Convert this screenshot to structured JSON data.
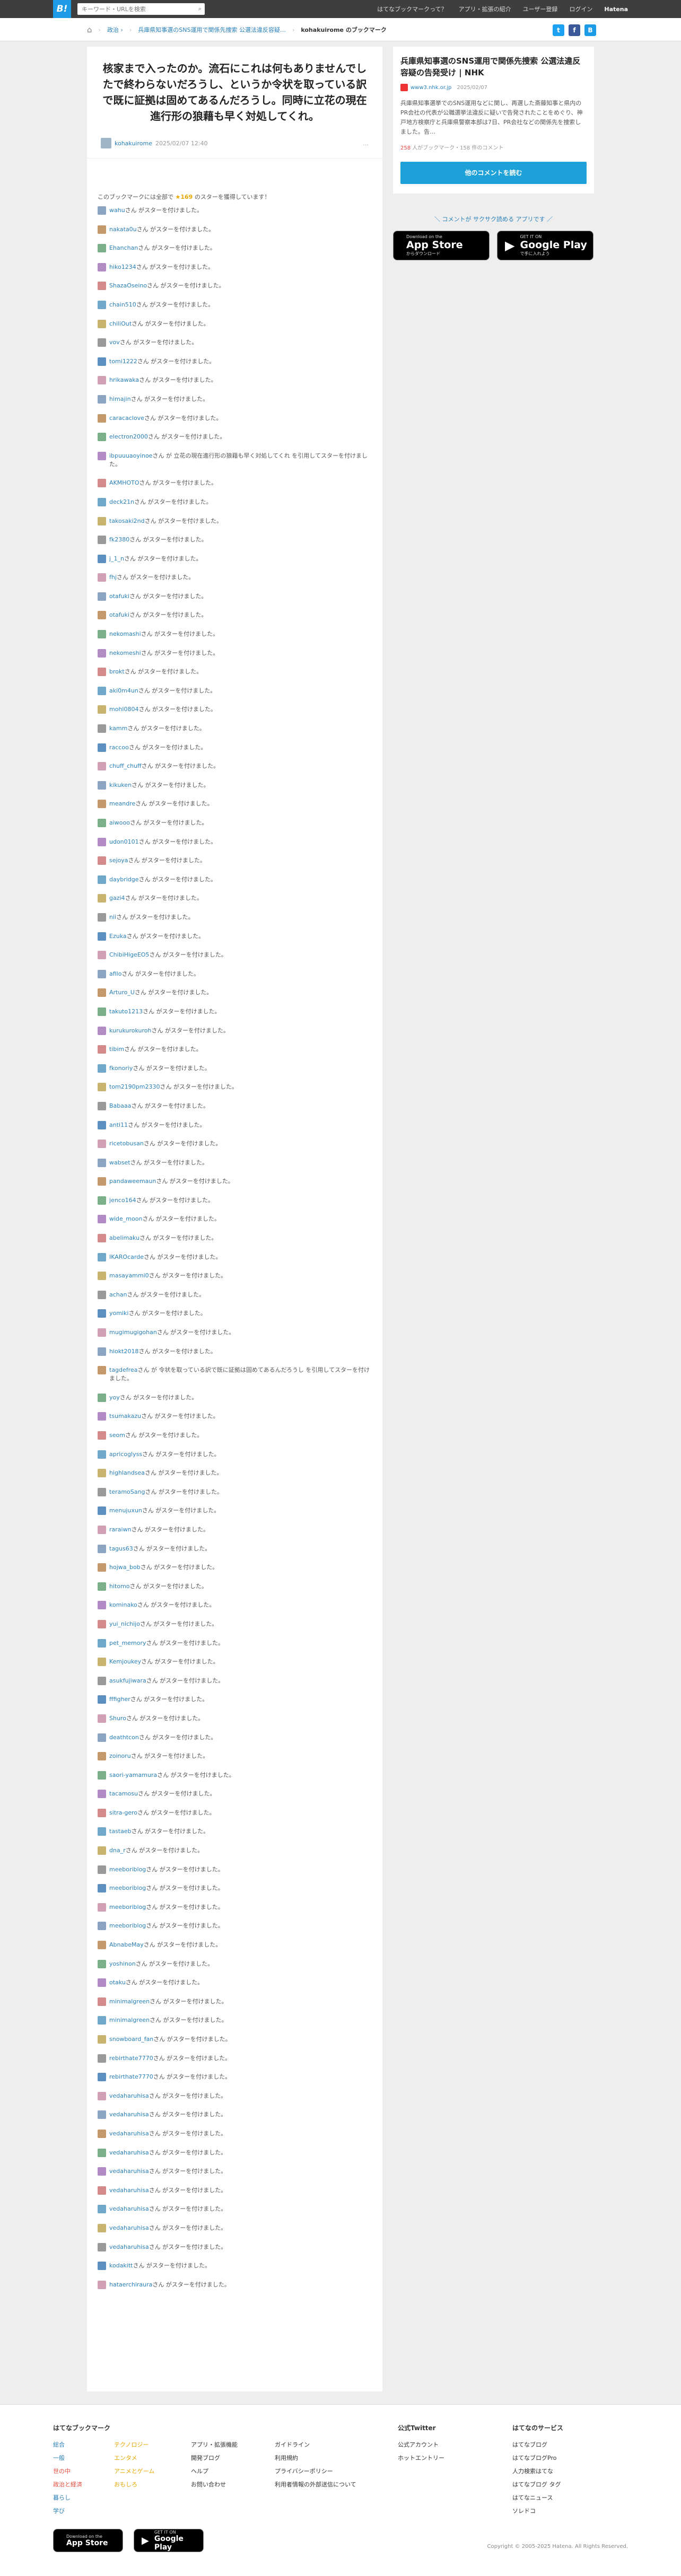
{
  "topbar": {
    "logo": "B!",
    "search_placeholder": "キーワード・URLを検索",
    "nav": [
      "はてなブックマークって？",
      "アプリ・拡張の紹介",
      "ユーザー登録",
      "ログイン",
      "Hatena"
    ]
  },
  "breadcrumb": {
    "items": [
      "政治 ›",
      "兵庫県知事選のSNS運用で関係先捜索 公選法違反容疑…",
      "kohakuirome のブックマーク"
    ]
  },
  "comment": {
    "text": "核家まで入ったのか。流石にこれは何もありませんでしたで終わらないだろうし、というか令状を取っている訳で既に証拠は固めてあるんだろうし。同時に立花の現在進行形の狼藉も早く対処してくれ。",
    "user": "kohakuirome",
    "date": "2025/02/07 12:40",
    "more": "…"
  },
  "stars": {
    "head_prefix": "このブックマークには全部で",
    "count": "★169",
    "head_suffix": "のスターを獲得しています！",
    "rows": [
      {
        "user": "wahu",
        "msg": "さん がスターを付けました。"
      },
      {
        "user": "nakata0u",
        "msg": "さん がスターを付けました。"
      },
      {
        "user": "Ehanchan",
        "msg": "さん がスターを付けました。"
      },
      {
        "user": "hiko1234",
        "msg": "さん がスターを付けました。"
      },
      {
        "user": "ShazaOseino",
        "msg": "さん がスターを付けました。"
      },
      {
        "user": "chain510",
        "msg": "さん がスターを付けました。"
      },
      {
        "user": "chiliOut",
        "msg": "さん がスターを付けました。"
      },
      {
        "user": "vov",
        "msg": "さん がスターを付けました。"
      },
      {
        "user": "tomi1222",
        "msg": "さん がスターを付けました。"
      },
      {
        "user": "hrikawaka",
        "msg": "さん がスターを付けました。"
      },
      {
        "user": "himajin",
        "msg": "さん がスターを付けました。"
      },
      {
        "user": "caracaclove",
        "msg": "さん がスターを付けました。"
      },
      {
        "user": "electron2000",
        "msg": "さん がスターを付けました。"
      },
      {
        "user": "ibpuuuaoyinoe",
        "msg": "さん が 立花の現在進行形の狼藉も早く対処してくれ を引用してスターを付けました。"
      },
      {
        "user": "AKMHOTO",
        "msg": "さん がスターを付けました。"
      },
      {
        "user": "deck21n",
        "msg": "さん がスターを付けました。"
      },
      {
        "user": "takosaki2nd",
        "msg": "さん がスターを付けました。"
      },
      {
        "user": "fk2380",
        "msg": "さん がスターを付けました。"
      },
      {
        "user": "j_1_n",
        "msg": "さん がスターを付けました。"
      },
      {
        "user": "fhj",
        "msg": "さん がスターを付けました。"
      },
      {
        "user": "otafuki",
        "msg": "さん がスターを付けました。"
      },
      {
        "user": "otafuki",
        "msg": "さん がスターを付けました。"
      },
      {
        "user": "nekomashi",
        "msg": "さん がスターを付けました。"
      },
      {
        "user": "nekomeshi",
        "msg": "さん がスターを付けました。"
      },
      {
        "user": "brokt",
        "msg": "さん がスターを付けました。"
      },
      {
        "user": "aki0m4un",
        "msg": "さん がスターを付けました。"
      },
      {
        "user": "mohl0804",
        "msg": "さん がスターを付けました。"
      },
      {
        "user": "kamm",
        "msg": "さん がスターを付けました。"
      },
      {
        "user": "raccoo",
        "msg": "さん がスターを付けました。"
      },
      {
        "user": "chuff_chuff",
        "msg": "さん がスターを付けました。"
      },
      {
        "user": "kikuken",
        "msg": "さん がスターを付けました。"
      },
      {
        "user": "meandre",
        "msg": "さん がスターを付けました。"
      },
      {
        "user": "aiwooo",
        "msg": "さん がスターを付けました。"
      },
      {
        "user": "udon0101",
        "msg": "さん がスターを付けました。"
      },
      {
        "user": "sejoya",
        "msg": "さん がスターを付けました。"
      },
      {
        "user": "daybridge",
        "msg": "さん がスターを付けました。"
      },
      {
        "user": "gazi4",
        "msg": "さん がスターを付けました。"
      },
      {
        "user": "nii",
        "msg": "さん がスターを付けました。"
      },
      {
        "user": "Ezuka",
        "msg": "さん がスターを付けました。"
      },
      {
        "user": "ChibiHigeEO5",
        "msg": "さん がスターを付けました。"
      },
      {
        "user": "afilo",
        "msg": "さん がスターを付けました。"
      },
      {
        "user": "Arturo_U",
        "msg": "さん がスターを付けました。"
      },
      {
        "user": "takuto1213",
        "msg": "さん がスターを付けました。"
      },
      {
        "user": "kurukurokuroh",
        "msg": "さん がスターを付けました。"
      },
      {
        "user": "tibim",
        "msg": "さん がスターを付けました。"
      },
      {
        "user": "fkonoriy",
        "msg": "さん がスターを付けました。"
      },
      {
        "user": "tom2190pm2330",
        "msg": "さん がスターを付けました。"
      },
      {
        "user": "Babaaa",
        "msg": "さん がスターを付けました。"
      },
      {
        "user": "anti11",
        "msg": "さん がスターを付けました。"
      },
      {
        "user": "ricetobusan",
        "msg": "さん がスターを付けました。"
      },
      {
        "user": "wabset",
        "msg": "さん がスターを付けました。"
      },
      {
        "user": "pandaweemaun",
        "msg": "さん がスターを付けました。"
      },
      {
        "user": "jenco164",
        "msg": "さん がスターを付けました。"
      },
      {
        "user": "wide_moon",
        "msg": "さん がスターを付けました。"
      },
      {
        "user": "abelimaku",
        "msg": "さん がスターを付けました。"
      },
      {
        "user": "IKAROcarde",
        "msg": "さん がスターを付けました。"
      },
      {
        "user": "masayammi0",
        "msg": "さん がスターを付けました。"
      },
      {
        "user": "achan",
        "msg": "さん がスターを付けました。"
      },
      {
        "user": "yomiki",
        "msg": "さん がスターを付けました。"
      },
      {
        "user": "mugimugigohan",
        "msg": "さん がスターを付けました。"
      },
      {
        "user": "hiokt2018",
        "msg": "さん がスターを付けました。"
      },
      {
        "user": "tagdefrea",
        "msg": "さん が 令状を取っている訳で既に証拠は固めてあるんだろうし を引用してスターを付けました。"
      },
      {
        "user": "yoy",
        "msg": "さん がスターを付けました。"
      },
      {
        "user": "tsumakazu",
        "msg": "さん がスターを付けました。"
      },
      {
        "user": "seom",
        "msg": "さん がスターを付けました。"
      },
      {
        "user": "apricoglyss",
        "msg": "さん がスターを付けました。"
      },
      {
        "user": "highlandsea",
        "msg": "さん がスターを付けました。"
      },
      {
        "user": "teramoSang",
        "msg": "さん がスターを付けました。"
      },
      {
        "user": "menujuxun",
        "msg": "さん がスターを付けました。"
      },
      {
        "user": "raraiwn",
        "msg": "さん がスターを付けました。"
      },
      {
        "user": "tagus63",
        "msg": "さん がスターを付けました。"
      },
      {
        "user": "hojwa_bob",
        "msg": "さん がスターを付けました。"
      },
      {
        "user": "hitomo",
        "msg": "さん がスターを付けました。"
      },
      {
        "user": "kominako",
        "msg": "さん がスターを付けました。"
      },
      {
        "user": "yui_nichijo",
        "msg": "さん がスターを付けました。"
      },
      {
        "user": "pet_memory",
        "msg": "さん がスターを付けました。"
      },
      {
        "user": "Kemjoukey",
        "msg": "さん がスターを付けました。"
      },
      {
        "user": "asukfujiwara",
        "msg": "さん がスターを付けました。"
      },
      {
        "user": "fffigher",
        "msg": "さん がスターを付けました。"
      },
      {
        "user": "Shuro",
        "msg": "さん がスターを付けました。"
      },
      {
        "user": "deathtcon",
        "msg": "さん がスターを付けました。"
      },
      {
        "user": "zoinoru",
        "msg": "さん がスターを付けました。"
      },
      {
        "user": "saori-yamamura",
        "msg": "さん がスターを付けました。"
      },
      {
        "user": "tacamosu",
        "msg": "さん がスターを付けました。"
      },
      {
        "user": "sitra-gero",
        "msg": "さん がスターを付けました。"
      },
      {
        "user": "tastaeb",
        "msg": "さん がスターを付けました。"
      },
      {
        "user": "dna_r",
        "msg": "さん がスターを付けました。"
      },
      {
        "user": "meeboriblog",
        "msg": "さん がスターを付けました。"
      },
      {
        "user": "meeboriblog",
        "msg": "さん がスターを付けました。"
      },
      {
        "user": "meeboriblog",
        "msg": "さん がスターを付けました。"
      },
      {
        "user": "meeboriblog",
        "msg": "さん がスターを付けました。"
      },
      {
        "user": "AbnabeMay",
        "msg": "さん がスターを付けました。"
      },
      {
        "user": "yoshinon",
        "msg": "さん がスターを付けました。"
      },
      {
        "user": "otaku",
        "msg": "さん がスターを付けました。"
      },
      {
        "user": "minimalgreen",
        "msg": "さん がスターを付けました。"
      },
      {
        "user": "minimalgreen",
        "msg": "さん がスターを付けました。"
      },
      {
        "user": "snowboard_fan",
        "msg": "さん がスターを付けました。"
      },
      {
        "user": "rebirthate7770",
        "msg": "さん がスターを付けました。"
      },
      {
        "user": "rebirthate7770",
        "msg": "さん がスターを付けました。"
      },
      {
        "user": "vedaharuhisa",
        "msg": "さん がスターを付けました。"
      },
      {
        "user": "vedaharuhisa",
        "msg": "さん がスターを付けました。"
      },
      {
        "user": "vedaharuhisa",
        "msg": "さん がスターを付けました。"
      },
      {
        "user": "vedaharuhisa",
        "msg": "さん がスターを付けました。"
      },
      {
        "user": "vedaharuhisa",
        "msg": "さん がスターを付けました。"
      },
      {
        "user": "vedaharuhisa",
        "msg": "さん がスターを付けました。"
      },
      {
        "user": "vedaharuhisa",
        "msg": "さん がスターを付けました。"
      },
      {
        "user": "vedaharuhisa",
        "msg": "さん がスターを付けました。"
      },
      {
        "user": "vedaharuhisa",
        "msg": "さん がスターを付けました。"
      },
      {
        "user": "kodakitt",
        "msg": "さん がスターを付けました。"
      },
      {
        "user": "hataerchiraura",
        "msg": "さん がスターを付けました。"
      }
    ]
  },
  "entry": {
    "title": "兵庫県知事選のSNS運用で関係先捜索 公選法違反容疑の告発受け | NHK",
    "domain": "www3.nhk.or.jp",
    "date": "2025/02/07",
    "desc": "兵庫県知事選挙でのSNS運用などに関し、再選した斎藤知事と県内のPR会社の代表が公職選挙法違反に疑いで告発されたことをめぐり、神戸地方検察庁と兵庫県警察本部は7日、PR会社などの関係先を捜索しました。告…",
    "users": "258 ",
    "users_suffix": "人がブックマーク・158 件のコメント",
    "button": "他のコメントを読む"
  },
  "app_promo": {
    "text": "＼ コメントが サクサク読める アプリです ／",
    "appstore_small": "Download on the",
    "appstore": "App Store",
    "appstore_sub": "からダウンロード",
    "play_small": "GET IT ON",
    "play": "Google Play",
    "play_sub": "で手に入れよう"
  },
  "footer": {
    "col1": {
      "head": "はてなブックマーク",
      "links": [
        "総合",
        "一般",
        "世の中",
        "政治と経済",
        "暮らし",
        "学び"
      ]
    },
    "col2": {
      "links": [
        "テクノロジー",
        "エンタメ",
        "アニメとゲーム",
        "おもしろ"
      ]
    },
    "col3": {
      "links": [
        "アプリ・拡張機能",
        "開発ブログ",
        "ヘルプ",
        "お問い合わせ"
      ]
    },
    "col4": {
      "links": [
        "ガイドライン",
        "利用規約",
        "プライバシーポリシー",
        "利用者情報の外部送信について"
      ]
    },
    "col5": {
      "head": "公式Twitter",
      "links": [
        "公式アカウント",
        "ホットエントリー"
      ]
    },
    "col6": {
      "head": "はてなのサービス",
      "links": [
        "はてなブログ",
        "はてなブログPro",
        "人力検索はてな",
        "はてなブログ タグ",
        "はてなニュース",
        "ソレドコ"
      ]
    },
    "copyright": "Copyright © 2005-2025 Hatena. All Rights Reserved."
  },
  "colors": {
    "accent": "#1e9be6",
    "star": "#e8a800",
    "topbar": "#3e3e3e"
  }
}
